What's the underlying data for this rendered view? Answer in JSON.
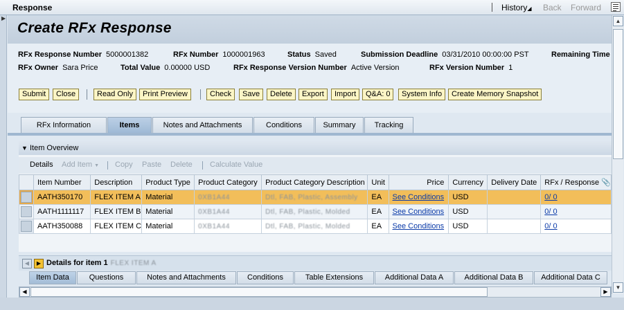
{
  "window": {
    "title": "Response",
    "history": "History",
    "back": "Back",
    "forward": "Forward"
  },
  "page": {
    "title": "Create RFx Response"
  },
  "info": {
    "response_number_label": "RFx Response Number",
    "response_number": "5000001382",
    "rfx_number_label": "RFx Number",
    "rfx_number": "1000001963",
    "status_label": "Status",
    "status": "Saved",
    "deadline_label": "Submission Deadline",
    "deadline": "03/31/2010 00:00:00 PST",
    "remaining_label": "Remaining Time",
    "owner_label": "RFx Owner",
    "owner": "Sara Price",
    "total_label": "Total Value",
    "total": "0.00000 USD",
    "version_num_label": "RFx Response Version Number",
    "version_num": "Active Version",
    "rfx_version_label": "RFx Version Number",
    "rfx_version": "1"
  },
  "buttons": {
    "submit": "Submit",
    "close": "Close",
    "read_only": "Read Only",
    "print_preview": "Print Preview",
    "check": "Check",
    "save": "Save",
    "delete": "Delete",
    "export": "Export",
    "import": "Import",
    "qa": "Q&A: 0",
    "system_info": "System Info",
    "memory_snapshot": "Create Memory Snapshot"
  },
  "tabs": [
    "RFx Information",
    "Items",
    "Notes and Attachments",
    "Conditions",
    "Summary",
    "Tracking"
  ],
  "item_overview": {
    "title": "Item Overview",
    "toolbar": {
      "details": "Details",
      "add_item": "Add Item",
      "copy": "Copy",
      "paste": "Paste",
      "delete": "Delete",
      "calculate": "Calculate Value"
    },
    "columns": [
      "Item Number",
      "Description",
      "Product Type",
      "Product Category",
      "Product Category Description",
      "Unit",
      "Price",
      "Currency",
      "Delivery Date",
      "RFx / Response"
    ],
    "rows": [
      {
        "item": "AATH350170",
        "desc": "FLEX ITEM A",
        "type": "Material",
        "cat": "0XB1A44",
        "catdesc": "Dtl, FAB, Plastic, Assembly",
        "unit": "EA",
        "price": "See Conditions",
        "currency": "USD",
        "delivery": "",
        "response": "0/ 0"
      },
      {
        "item": "AATH1111117",
        "desc": "FLEX ITEM B",
        "type": "Material",
        "cat": "0XB1A44",
        "catdesc": "Dtl, FAB, Plastic, Molded",
        "unit": "EA",
        "price": "See Conditions",
        "currency": "USD",
        "delivery": "",
        "response": "0/ 0"
      },
      {
        "item": "AATH350088",
        "desc": "FLEX ITEM C",
        "type": "Material",
        "cat": "0XB1A44",
        "catdesc": "Dtl, FAB, Plastic, Molded",
        "unit": "EA",
        "price": "See Conditions",
        "currency": "USD",
        "delivery": "",
        "response": "0/ 0"
      }
    ]
  },
  "details": {
    "title": "Details for item 1",
    "item_name": "FLEX ITEM A"
  },
  "detail_tabs": [
    "Item Data",
    "Questions",
    "Notes and Attachments",
    "Conditions",
    "Table Extensions",
    "Additional Data A",
    "Additional Data B",
    "Additional Data C"
  ]
}
